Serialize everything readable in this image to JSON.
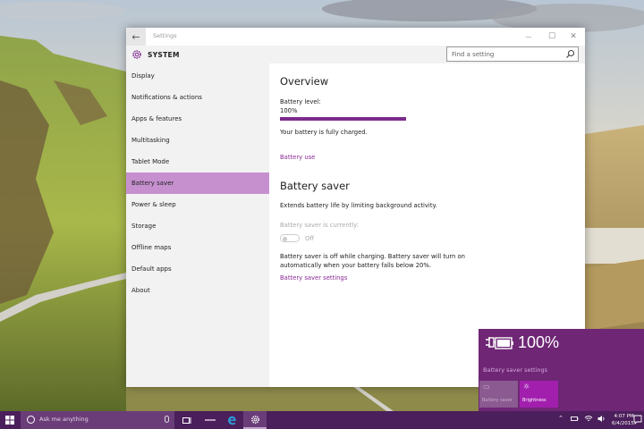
{
  "window": {
    "title": "Settings",
    "back_glyph": "←",
    "minimize_glyph": "—",
    "maximize_glyph": "☐",
    "close_glyph": "✕"
  },
  "sidebar": {
    "header": "SYSTEM",
    "header_icon": "gear-icon",
    "items": [
      {
        "label": "Display",
        "active": false
      },
      {
        "label": "Notifications & actions",
        "active": false
      },
      {
        "label": "Apps & features",
        "active": false
      },
      {
        "label": "Multitasking",
        "active": false
      },
      {
        "label": "Tablet Mode",
        "active": false
      },
      {
        "label": "Battery saver",
        "active": true
      },
      {
        "label": "Power & sleep",
        "active": false
      },
      {
        "label": "Storage",
        "active": false
      },
      {
        "label": "Offline maps",
        "active": false
      },
      {
        "label": "Default apps",
        "active": false
      },
      {
        "label": "About",
        "active": false
      }
    ]
  },
  "search": {
    "placeholder": "Find a setting",
    "icon": "search-icon"
  },
  "overview": {
    "heading": "Overview",
    "battery_level_label": "Battery level:",
    "battery_level_value": "100%",
    "battery_fraction": 1.0,
    "status": "Your battery is fully charged.",
    "battery_use_link": "Battery use"
  },
  "battery_saver": {
    "heading": "Battery saver",
    "description": "Extends battery life by limiting background activity.",
    "currently_label": "Battery saver is currently:",
    "toggle_state": "Off",
    "note_line1": "Battery saver is off while charging. Battery saver will turn on",
    "note_line2": "automatically when your battery falls below 20%.",
    "settings_link": "Battery saver settings"
  },
  "flyout": {
    "percent": "100%",
    "settings_link": "Battery saver settings",
    "tiles": [
      {
        "label": "Battery saver",
        "icon": "battery-saver-icon"
      },
      {
        "label": "Brightness",
        "icon": "brightness-icon"
      }
    ]
  },
  "taskbar": {
    "search_placeholder": "Ask me anything",
    "time": "4:07 PM",
    "date": "6/4/2015"
  },
  "colors": {
    "accent": "#7c2a8b",
    "sidebar_active": "#c690cf",
    "flyout_bg": "#6e2675",
    "taskbar_bg": "#4b1f5b",
    "link": "#8a2a94"
  }
}
